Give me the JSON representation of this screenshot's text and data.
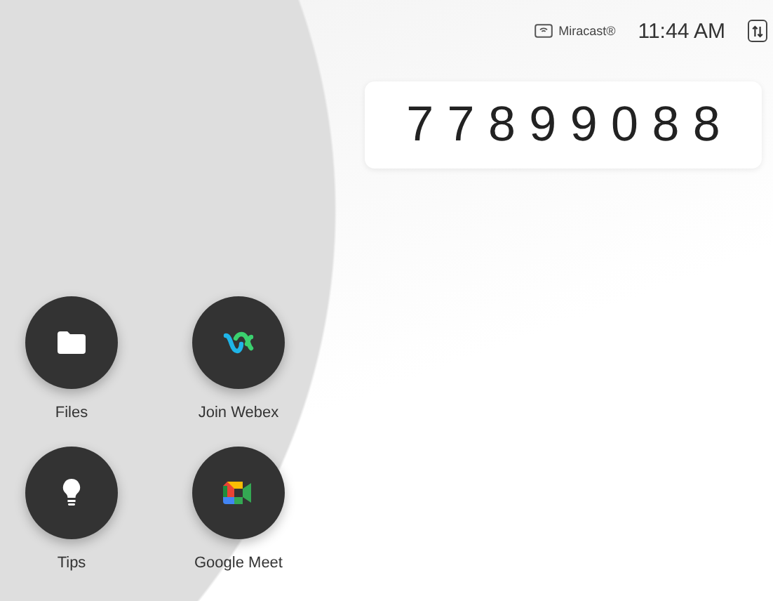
{
  "status_bar": {
    "cast_label": "Miracast®",
    "time": "11:44 AM"
  },
  "dial_display": {
    "value": "7 7 8 9 9 0 8 8"
  },
  "apps": [
    {
      "label": "Files",
      "kind": "files"
    },
    {
      "label": "Join Webex",
      "kind": "webex"
    },
    {
      "label": "Tips",
      "kind": "tips"
    },
    {
      "label": "Google Meet",
      "kind": "meet"
    }
  ]
}
